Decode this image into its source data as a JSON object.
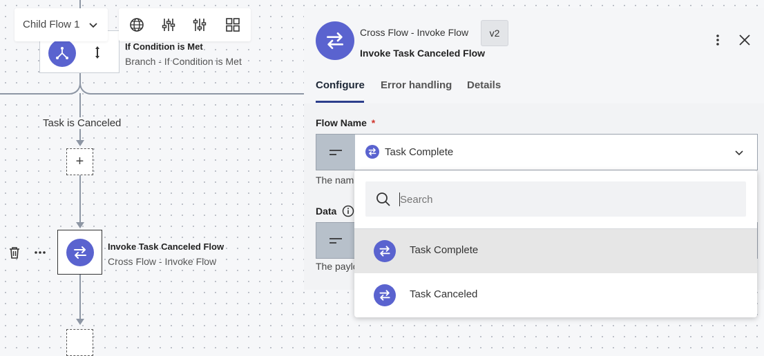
{
  "toolbar": {
    "flow_selector": "Child Flow 1",
    "icons": [
      "globe-icon",
      "sliders-icon",
      "sliders-alt-icon",
      "grid-icon"
    ]
  },
  "canvas": {
    "branch_node": {
      "title": "If Condition is Met",
      "subtitle": "Branch - If Condition is Met"
    },
    "edge_label": "Task is Canceled",
    "invoke_node": {
      "title": "Invoke Task Canceled Flow",
      "subtitle": "Cross Flow - Invoke Flow"
    }
  },
  "panel": {
    "type": "Cross Flow - Invoke Flow",
    "version": "v2",
    "title": "Invoke Task Canceled Flow",
    "tabs": [
      {
        "label": "Configure",
        "active": true
      },
      {
        "label": "Error handling",
        "active": false
      },
      {
        "label": "Details",
        "active": false
      }
    ],
    "flow_name": {
      "label": "Flow Name",
      "required_mark": "*",
      "value": "Task Complete",
      "helper": "The nam"
    },
    "data_field": {
      "label": "Data",
      "helper": "The paylo"
    }
  },
  "dropdown": {
    "search_placeholder": "Search",
    "options": [
      {
        "label": "Task Complete",
        "highlighted": true
      },
      {
        "label": "Task Canceled",
        "highlighted": false
      }
    ]
  },
  "colors": {
    "accent": "#5a63cf",
    "tab_underline": "#2c3e8c",
    "required": "#d0342c",
    "highlight": "#e6e6e6"
  }
}
